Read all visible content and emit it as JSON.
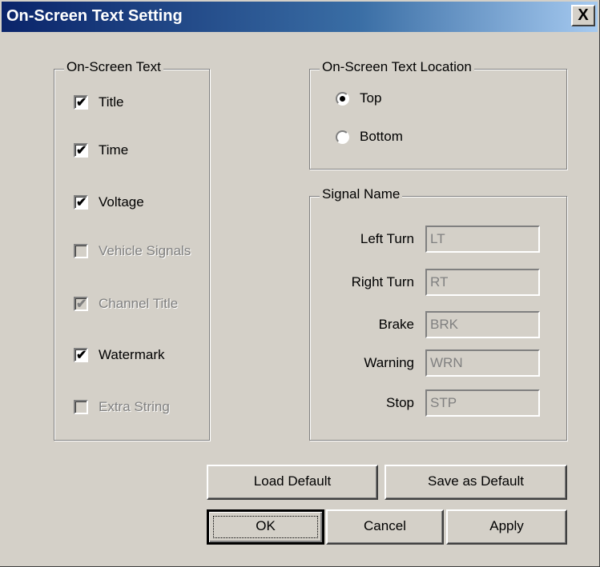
{
  "window": {
    "title": "On-Screen Text Setting",
    "close_label": "X"
  },
  "on_screen_text": {
    "label": "On-Screen Text",
    "items": [
      {
        "label": "Title",
        "checked": true,
        "enabled": true
      },
      {
        "label": "Time",
        "checked": true,
        "enabled": true
      },
      {
        "label": "Voltage",
        "checked": true,
        "enabled": true
      },
      {
        "label": "Vehicle Signals",
        "checked": false,
        "enabled": false
      },
      {
        "label": "Channel Title",
        "checked": true,
        "enabled": false
      },
      {
        "label": "Watermark",
        "checked": true,
        "enabled": true
      },
      {
        "label": "Extra String",
        "checked": false,
        "enabled": false
      }
    ]
  },
  "location": {
    "label": "On-Screen Text Location",
    "options": [
      {
        "label": "Top",
        "selected": true
      },
      {
        "label": "Bottom",
        "selected": false
      }
    ]
  },
  "signal_name": {
    "label": "Signal Name",
    "fields": [
      {
        "label": "Left Turn",
        "value": "LT"
      },
      {
        "label": "Right Turn",
        "value": "RT"
      },
      {
        "label": "Brake",
        "value": "BRK"
      },
      {
        "label": "Warning",
        "value": "WRN"
      },
      {
        "label": "Stop",
        "value": "STP"
      }
    ]
  },
  "buttons": {
    "load_default": "Load Default",
    "save_default": "Save as Default",
    "ok": "OK",
    "cancel": "Cancel",
    "apply": "Apply"
  }
}
